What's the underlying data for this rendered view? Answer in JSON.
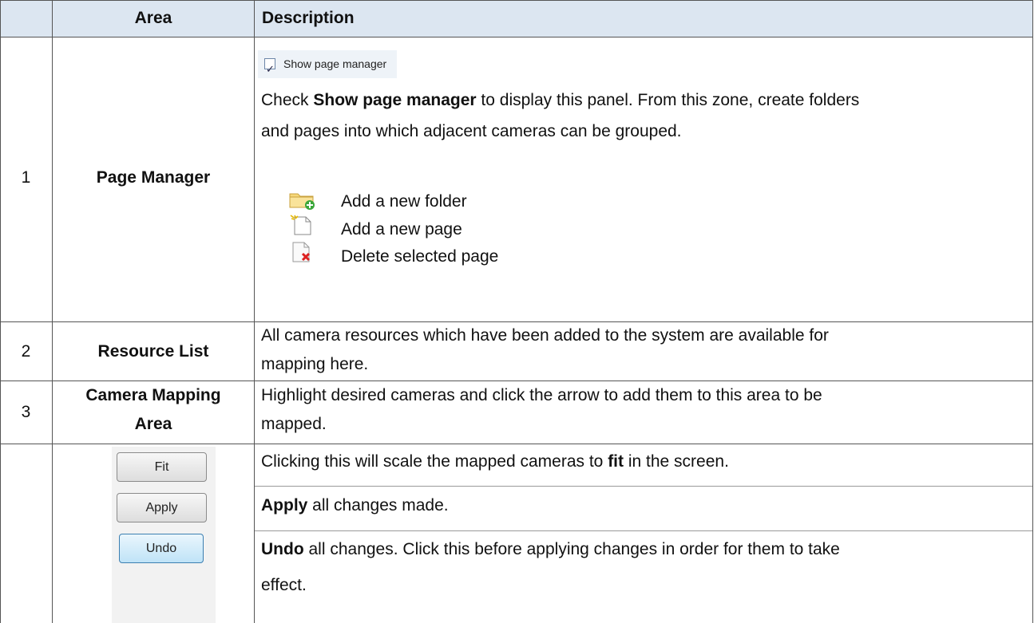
{
  "header": {
    "area": "Area",
    "description": "Description"
  },
  "rows": [
    {
      "num": "1",
      "area": "Page Manager",
      "checkbox_label": "Show page manager",
      "desc_pre": "Check ",
      "desc_bold": "Show page manager",
      "desc_line1_rest": " to display this panel. From this zone, create folders",
      "desc_line2": "and pages into which adjacent cameras can be grouped.",
      "icons": [
        {
          "name": "add-folder-icon",
          "label": "Add a new folder"
        },
        {
          "name": "add-page-icon",
          "label": "Add a new page"
        },
        {
          "name": "delete-page-icon",
          "label": "Delete selected page"
        }
      ]
    },
    {
      "num": "2",
      "area": "Resource List",
      "desc_line1": "All camera resources which have been added to the system are available for",
      "desc_line2": "mapping here."
    },
    {
      "num": "3",
      "area_line1": "Camera Mapping",
      "area_line2": "Area",
      "desc_line1": "Highlight desired cameras and click the arrow to add them to this area to be",
      "desc_line2": "mapped."
    },
    {
      "buttons": [
        "Fit",
        "Apply",
        "Undo"
      ],
      "fit_desc_pre": "Clicking this will scale the mapped cameras to ",
      "fit_desc_bold": "fit",
      "fit_desc_post": " in the screen.",
      "apply_bold": "Apply",
      "apply_rest": " all changes made.",
      "undo_bold": "Undo",
      "undo_rest_line1": " all changes. Click this before applying changes in order for them to take",
      "undo_line2": "effect."
    }
  ]
}
